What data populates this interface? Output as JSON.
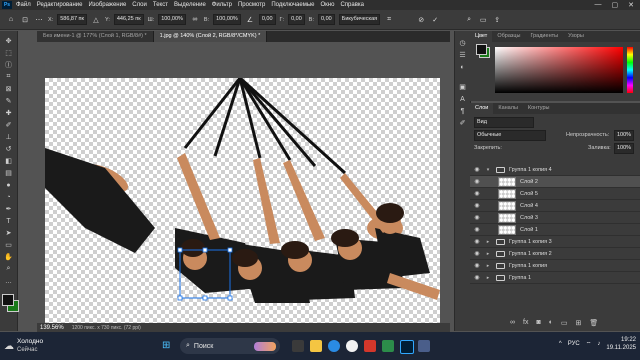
{
  "menu": {
    "items": [
      "Файл",
      "Редактирование",
      "Изображение",
      "Слои",
      "Текст",
      "Выделение",
      "Фильтр",
      "Просмотр",
      "Подключаемые",
      "Окно",
      "Справка"
    ],
    "window_controls": [
      "—",
      "▢",
      "✕"
    ]
  },
  "options": {
    "x_label": "X:",
    "x_value": "586,87 пк",
    "y_label": "Y:",
    "y_value": "446,25 пк",
    "w_label": "Ш:",
    "w_value": "100,00%",
    "h_label": "В:",
    "h_value": "100,00%",
    "angle_value": "0,00",
    "hskew_label": "Г:",
    "hskew_value": "0,00",
    "vskew_label": "В:",
    "vskew_value": "0,00",
    "interp_value": "Бикубическая"
  },
  "tabs": [
    {
      "label": "Без имени-1 @ 177% (Слой 1, RGB/8#) *",
      "active": false
    },
    {
      "label": "1.jpg @ 140% (Слой 2, RGB/8*/CMYK) *",
      "active": true
    }
  ],
  "status": {
    "zoom": "139.56%",
    "doc_info": "1200 пикс. x 730 пикс. (72 ppi)"
  },
  "color_panel": {
    "tabs": [
      "Цвет",
      "Образцы",
      "Градиенты",
      "Узоры"
    ],
    "colors": {
      "foreground": "#111111",
      "background": "#1a7a1a",
      "hue_red": "#ff0000"
    }
  },
  "layers_panel": {
    "tabs": [
      "Слои",
      "Каналы",
      "Контуры"
    ],
    "search_placeholder": "Вид",
    "blend_mode": "Обычные",
    "opacity_label": "Непрозрачность:",
    "opacity_value": "100%",
    "lock_label": "Закрепить:",
    "fill_label": "Заливка:",
    "fill_value": "100%",
    "layers": [
      {
        "name": "Группа 1 копия 4",
        "type": "group",
        "indent": 0,
        "selected": false,
        "open": true
      },
      {
        "name": "Слой 2",
        "type": "layer",
        "indent": 1,
        "selected": true
      },
      {
        "name": "Слой 5",
        "type": "layer",
        "indent": 1,
        "selected": false
      },
      {
        "name": "Слой 4",
        "type": "layer",
        "indent": 1,
        "selected": false
      },
      {
        "name": "Слой 3",
        "type": "layer",
        "indent": 1,
        "selected": false
      },
      {
        "name": "Слой 1",
        "type": "layer",
        "indent": 1,
        "selected": false
      },
      {
        "name": "Группа 1 копия 3",
        "type": "group",
        "indent": 0,
        "selected": false
      },
      {
        "name": "Группа 1 копия 2",
        "type": "group",
        "indent": 0,
        "selected": false
      },
      {
        "name": "Группа 1 копия",
        "type": "group",
        "indent": 0,
        "selected": false
      },
      {
        "name": "Группа 1",
        "type": "group",
        "indent": 0,
        "selected": false
      }
    ]
  },
  "taskbar": {
    "weather_temp": "Холодно",
    "weather_sub": "Сейчас",
    "search_label": "Поиск",
    "language": "РУС",
    "time": "19:22",
    "date": "19.11.2025"
  },
  "toolbar": {
    "tools": [
      "move-icon",
      "artboard-icon",
      "lasso-icon",
      "crop-icon",
      "frame-icon",
      "eyedropper-icon",
      "healing-icon",
      "brush-icon",
      "stamp-icon",
      "history-brush-icon",
      "eraser-icon",
      "gradient-icon",
      "blur-icon",
      "dodge-icon",
      "pen-icon",
      "type-icon",
      "path-select-icon",
      "rectangle-icon",
      "hand-icon",
      "zoom-icon",
      "more-icon"
    ],
    "fg_color": "#111111",
    "bg_color": "#1a7a1a"
  }
}
